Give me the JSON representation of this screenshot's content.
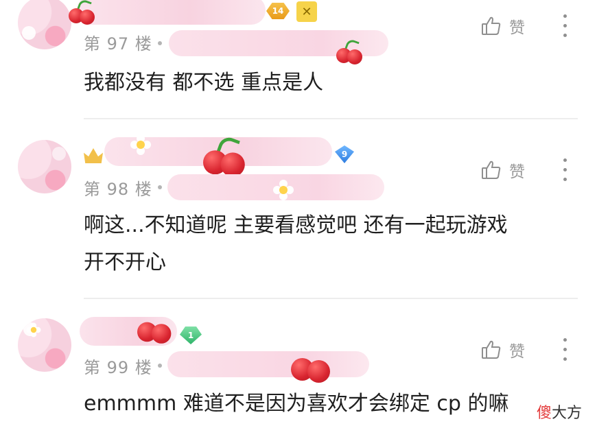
{
  "comments": [
    {
      "floor": "第 97 楼",
      "content_lines": [
        "我都没有 都不选 重点是人"
      ],
      "like_label": "赞",
      "level_badge": "14"
    },
    {
      "floor": "第 98 楼",
      "content_lines": [
        "啊这...不知道呢 主要看感觉吧 还有一起玩游戏",
        "开不开心"
      ],
      "like_label": "赞",
      "level_badge": "9"
    },
    {
      "floor": "第 99 楼",
      "content_lines": [
        "emmmm 难道不是因为喜欢才会绑定 cp 的嘛"
      ],
      "like_label": "赞",
      "level_badge": "1"
    }
  ],
  "watermark": {
    "first_char": "傻",
    "rest": "大方"
  },
  "icons": {
    "like": "thumbs-up-icon",
    "more": "more-vertical-icon"
  },
  "colors": {
    "floor_text": "#9a9a9a",
    "content_text": "#1f1f1f",
    "blur_pink": "#f8d3e0",
    "watermark_accent": "#e33b3b"
  }
}
